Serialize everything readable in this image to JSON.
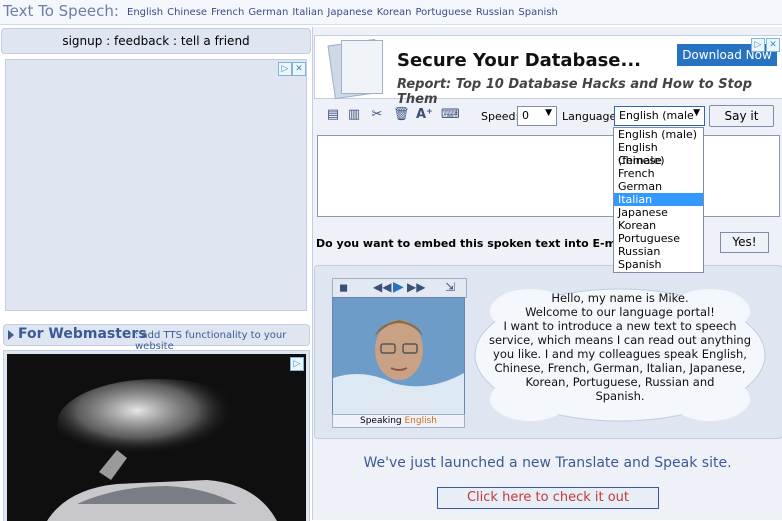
{
  "header": {
    "site_title": "Text To Speech:",
    "languages": [
      "English",
      "Chinese",
      "French",
      "German",
      "Italian",
      "Japanese",
      "Korean",
      "Portuguese",
      "Russian",
      "Spanish"
    ]
  },
  "left": {
    "signup_text": "signup : feedback : tell a friend",
    "webmasters_title": "For Webmasters",
    "webmasters_sub": ": add TTS functionality to your website"
  },
  "banner": {
    "title": "Secure Your Database...",
    "subtitle": "Report: Top 10 Database Hacks and How to Stop Them",
    "download_label": "Download Now"
  },
  "toolbar": {
    "speed_label": "Speed:",
    "speed_value": "0",
    "language_label": "Language:",
    "language_value": "English (male",
    "say_button": "Say it"
  },
  "dropdown": {
    "options": [
      "English (male)",
      "English (female)",
      "Chinese",
      "French",
      "German",
      "Italian",
      "Japanese",
      "Korean",
      "Portuguese",
      "Russian",
      "Spanish"
    ],
    "highlighted": "Italian"
  },
  "embed": {
    "question": "Do you want to embed this spoken text into E-mail or",
    "yes_button": "Yes!"
  },
  "speaker": {
    "speaking_label": "Speaking",
    "speaking_language": "English",
    "lines": [
      "Hello, my name is Mike.",
      "Welcome to our language portal!",
      "I want to introduce a new text to speech",
      "service, which means I can read out anything",
      "you like. I and my colleagues speak English,",
      "Chinese, French, German, Italian, Japanese,",
      "Korean, Portuguese, Russian and",
      "Spanish."
    ]
  },
  "promo": {
    "text": "We've just launched a new Translate and Speak site.",
    "button": "Click here to check it out"
  },
  "colors": {
    "accent": "#3a5a97",
    "panel": "#dfe6f1",
    "highlight": "#3399ff",
    "link_red": "#c33a3a"
  },
  "icons": [
    "doc-icon",
    "docs-icon",
    "cut-icon",
    "trash-icon",
    "font-size-icon",
    "keyboard-icon",
    "stop-icon",
    "rewind-icon",
    "play-icon",
    "forward-icon",
    "export-icon",
    "adchoices-icon",
    "close-icon"
  ]
}
